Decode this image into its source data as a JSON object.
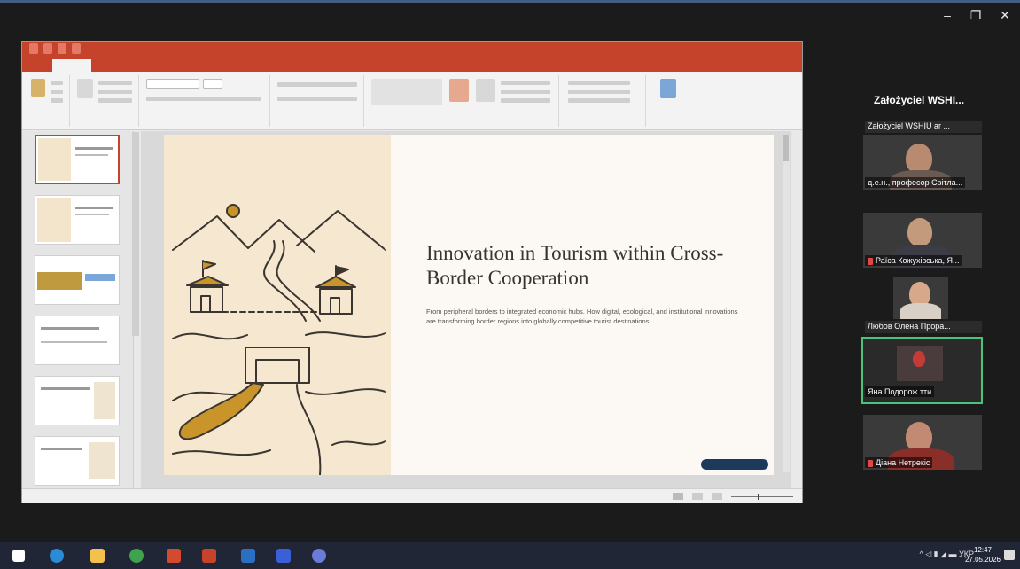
{
  "window_controls": {
    "minimize": "–",
    "maximize": "❐",
    "close": "✕"
  },
  "slide": {
    "title": "Innovation in Tourism within Cross-Border Cooperation",
    "description": "From peripheral borders to integrated economic hubs. How digital, ecological, and institutional innovations are transforming border regions into globally competitive tourist destinations."
  },
  "participants": {
    "host_header": "Założyciel WSHI...",
    "host_bar": "Założyciel WSHIU ar ...",
    "tiles": [
      {
        "label": "д.е.н., професор Світла..."
      },
      {
        "label": "Раїса Кожухівська, Я..."
      },
      {
        "label": "Любов Олена Прора..."
      },
      {
        "label": "Яна Подорож тти"
      },
      {
        "label": "Діана Нетрекіс"
      }
    ]
  },
  "taskbar": {
    "tray_lang": "УКР",
    "clock_time": "12:47",
    "clock_date": "27.05.2026"
  },
  "colors": {
    "ppt_accent": "#c6432b",
    "active_speaker": "#4ec27a",
    "slide_left_panel": "#f6e8d0",
    "slide_button": "#1e3a5a",
    "taskbar": "#202636"
  }
}
